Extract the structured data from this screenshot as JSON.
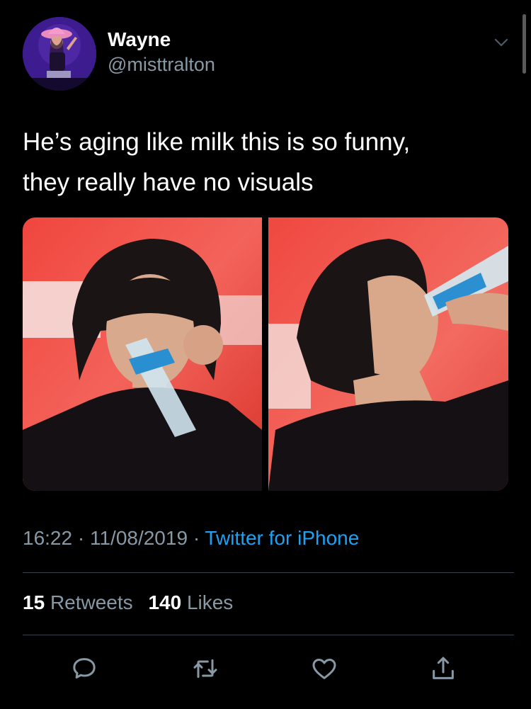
{
  "user": {
    "display_name": "Wayne",
    "handle": "@misttralton"
  },
  "tweet": {
    "text_lines": [
      "He’s aging like milk this is so funny,",
      "they really have no visuals"
    ],
    "media": [
      {
        "description_icon": "photo-icon"
      },
      {
        "description_icon": "photo-icon"
      }
    ]
  },
  "meta": {
    "time": "16:22",
    "separator": "·",
    "date": "11/08/2019",
    "source": "Twitter for iPhone"
  },
  "stats": {
    "retweets_count": "15",
    "retweets_label": "Retweets",
    "likes_count": "140",
    "likes_label": "Likes"
  },
  "actions": {
    "reply_icon": "reply-icon",
    "retweet_icon": "retweet-icon",
    "like_icon": "heart-icon",
    "share_icon": "share-icon"
  },
  "colors": {
    "background": "#000000",
    "text": "#ffffff",
    "secondary": "#8899a6",
    "accent": "#1da1f2",
    "divider": "#38444d"
  }
}
